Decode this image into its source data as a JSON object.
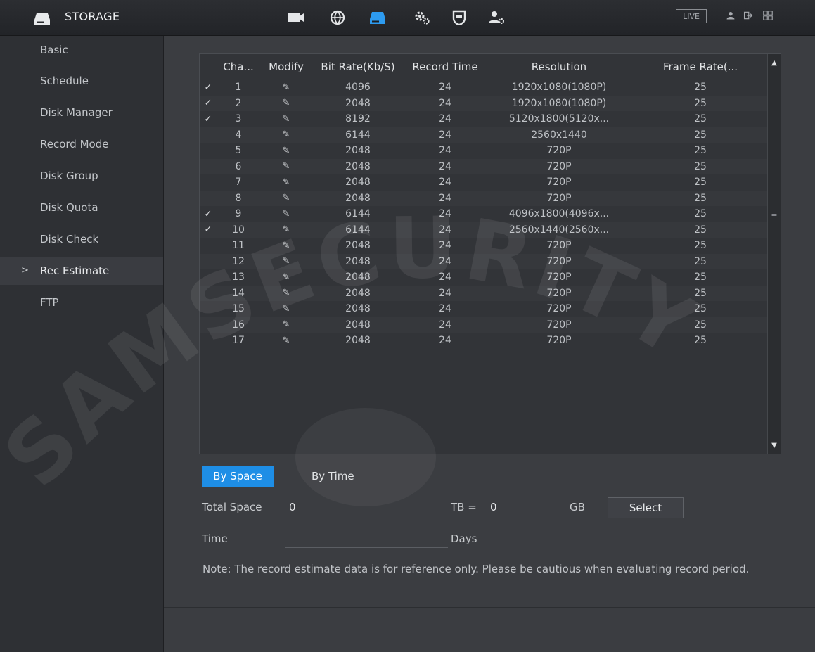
{
  "header": {
    "title": "STORAGE",
    "live_label": "LIVE",
    "nav_icons": [
      "camera-icon",
      "network-icon",
      "storage-icon",
      "settings-icon",
      "security-icon",
      "account-icon"
    ]
  },
  "sidebar": {
    "items": [
      {
        "label": "Basic"
      },
      {
        "label": "Schedule"
      },
      {
        "label": "Disk Manager"
      },
      {
        "label": "Record Mode"
      },
      {
        "label": "Disk Group"
      },
      {
        "label": "Disk Quota"
      },
      {
        "label": "Disk Check"
      },
      {
        "label": "Rec Estimate",
        "active": true
      },
      {
        "label": "FTP"
      }
    ],
    "active_marker": ">"
  },
  "table": {
    "columns": [
      "",
      "Cha...",
      "Modify",
      "Bit Rate(Kb/S)",
      "Record Time",
      "Resolution",
      "Frame Rate(..."
    ],
    "rows": [
      {
        "checked": true,
        "channel": "1",
        "bitrate": "4096",
        "record_time": "24",
        "resolution": "1920x1080(1080P)",
        "frame_rate": "25"
      },
      {
        "checked": true,
        "channel": "2",
        "bitrate": "2048",
        "record_time": "24",
        "resolution": "1920x1080(1080P)",
        "frame_rate": "25"
      },
      {
        "checked": true,
        "channel": "3",
        "bitrate": "8192",
        "record_time": "24",
        "resolution": "5120x1800(5120x...",
        "frame_rate": "25"
      },
      {
        "checked": false,
        "channel": "4",
        "bitrate": "6144",
        "record_time": "24",
        "resolution": "2560x1440",
        "frame_rate": "25"
      },
      {
        "checked": false,
        "channel": "5",
        "bitrate": "2048",
        "record_time": "24",
        "resolution": "720P",
        "frame_rate": "25"
      },
      {
        "checked": false,
        "channel": "6",
        "bitrate": "2048",
        "record_time": "24",
        "resolution": "720P",
        "frame_rate": "25"
      },
      {
        "checked": false,
        "channel": "7",
        "bitrate": "2048",
        "record_time": "24",
        "resolution": "720P",
        "frame_rate": "25"
      },
      {
        "checked": false,
        "channel": "8",
        "bitrate": "2048",
        "record_time": "24",
        "resolution": "720P",
        "frame_rate": "25"
      },
      {
        "checked": true,
        "channel": "9",
        "bitrate": "6144",
        "record_time": "24",
        "resolution": "4096x1800(4096x...",
        "frame_rate": "25"
      },
      {
        "checked": true,
        "channel": "10",
        "bitrate": "6144",
        "record_time": "24",
        "resolution": "2560x1440(2560x...",
        "frame_rate": "25"
      },
      {
        "checked": false,
        "channel": "11",
        "bitrate": "2048",
        "record_time": "24",
        "resolution": "720P",
        "frame_rate": "25"
      },
      {
        "checked": false,
        "channel": "12",
        "bitrate": "2048",
        "record_time": "24",
        "resolution": "720P",
        "frame_rate": "25"
      },
      {
        "checked": false,
        "channel": "13",
        "bitrate": "2048",
        "record_time": "24",
        "resolution": "720P",
        "frame_rate": "25"
      },
      {
        "checked": false,
        "channel": "14",
        "bitrate": "2048",
        "record_time": "24",
        "resolution": "720P",
        "frame_rate": "25"
      },
      {
        "checked": false,
        "channel": "15",
        "bitrate": "2048",
        "record_time": "24",
        "resolution": "720P",
        "frame_rate": "25"
      },
      {
        "checked": false,
        "channel": "16",
        "bitrate": "2048",
        "record_time": "24",
        "resolution": "720P",
        "frame_rate": "25"
      },
      {
        "checked": false,
        "channel": "17",
        "bitrate": "2048",
        "record_time": "24",
        "resolution": "720P",
        "frame_rate": "25"
      }
    ],
    "check_glyph": "✓",
    "modify_glyph": "✎"
  },
  "tabs": {
    "by_space": "By Space",
    "by_time": "By Time",
    "active": "by_space"
  },
  "form": {
    "total_space_label": "Total Space",
    "total_space_value": "0",
    "tb_label": "TB =",
    "gb_value": "0",
    "gb_label": "GB",
    "select_label": "Select",
    "time_label": "Time",
    "days_label": "Days"
  },
  "note": "Note: The record estimate data is for reference only. Please be cautious when evaluating record period.",
  "watermark": "SAMSECURITY",
  "colors": {
    "accent": "#1e8ee6",
    "background": "#3b3d41",
    "sidebar": "#2e3034"
  }
}
